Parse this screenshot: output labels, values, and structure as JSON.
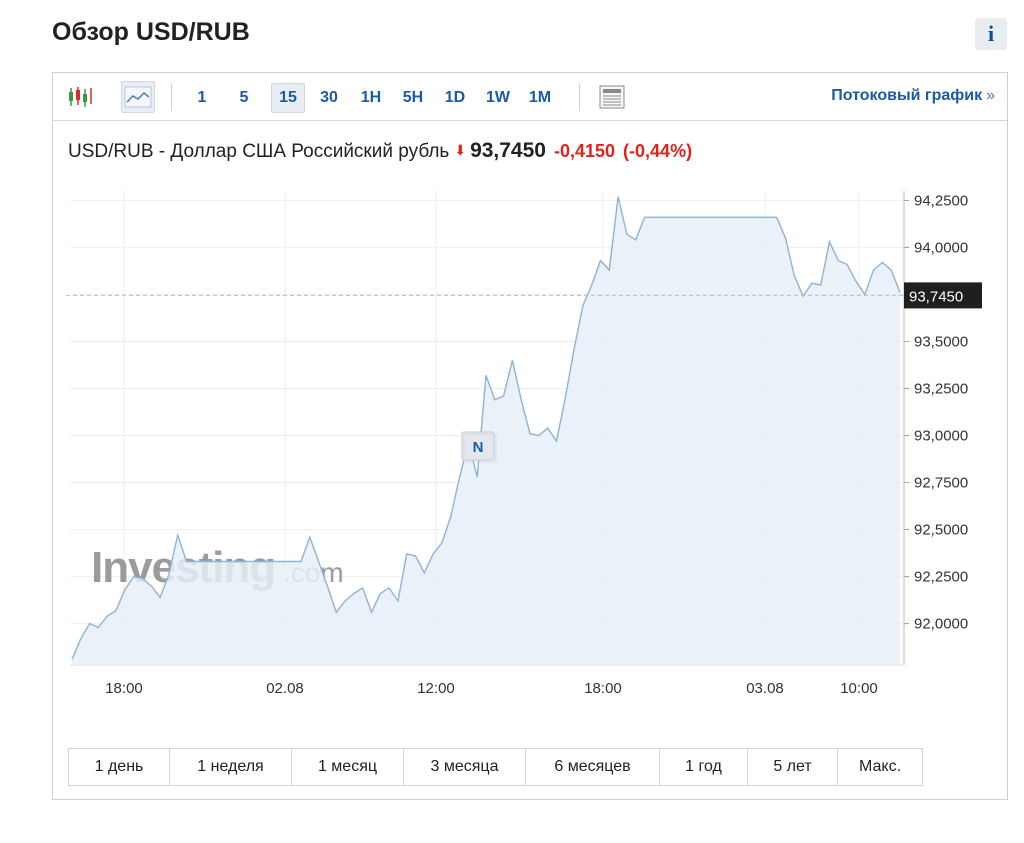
{
  "page": {
    "title": "Обзор USD/RUB",
    "info_label": "i"
  },
  "toolbar": {
    "timeframes": [
      "1",
      "5",
      "15",
      "30",
      "1H",
      "5H",
      "1D",
      "1W",
      "1M"
    ],
    "active_timeframe": "15",
    "stream_link": "Потоковый график",
    "stream_arrow": "»",
    "icons": [
      "candlestick-chart-icon",
      "area-chart-icon",
      "table-view-icon"
    ]
  },
  "quote": {
    "name": "USD/RUB - Доллар США Российский рубль",
    "price": "93,7450",
    "change": "-0,4150",
    "change_pct": "(-0,44%)",
    "direction_icon": "down-arrow-icon"
  },
  "watermark": {
    "brand": "Investing",
    "suffix": ".com"
  },
  "news_marker": "N",
  "ranges": [
    "1 день",
    "1 неделя",
    "1 месяц",
    "3 месяца",
    "6 месяцев",
    "1 год",
    "5 лет",
    "Макс."
  ],
  "colors": {
    "accent": "#1a5aa6",
    "down": "#e0231d",
    "line": "#8fb3d6",
    "fill": "#e8eef7",
    "price_tag_bg": "#1f1f1f"
  },
  "chart_data": {
    "type": "area",
    "x_ticks": [
      "18:00",
      "02.08",
      "12:00",
      "18:00",
      "03.08",
      "10:00"
    ],
    "y_ticks": [
      "92,0000",
      "92,2500",
      "92,5000",
      "92,7500",
      "93,0000",
      "93,2500",
      "93,5000",
      "93,7500",
      "94,0000",
      "94,2500"
    ],
    "ylim": [
      91.78,
      94.3
    ],
    "current_price_label": "93,7450",
    "current_price": 93.745,
    "grid": true,
    "series": [
      {
        "values": [
          91.81,
          91.92,
          92.0,
          91.98,
          92.04,
          92.07,
          92.18,
          92.25,
          92.24,
          92.2,
          92.14,
          92.26,
          92.47,
          92.33,
          92.33,
          92.33,
          92.33,
          92.33,
          92.33,
          92.33,
          92.33,
          92.33,
          92.33,
          92.33,
          92.33,
          92.33,
          92.33,
          92.46,
          92.33,
          92.2,
          92.06,
          92.12,
          92.16,
          92.19,
          92.06,
          92.16,
          92.19,
          92.12,
          92.37,
          92.36,
          92.27,
          92.37,
          92.43,
          92.57,
          92.78,
          92.96,
          92.78,
          93.32,
          93.19,
          93.21,
          93.4,
          93.19,
          93.01,
          93.0,
          93.04,
          92.97,
          93.2,
          93.46,
          93.69,
          93.8,
          93.93,
          93.88,
          94.27,
          94.07,
          94.04,
          94.16,
          94.16,
          94.16,
          94.16,
          94.16,
          94.16,
          94.16,
          94.16,
          94.16,
          94.16,
          94.16,
          94.16,
          94.16,
          94.16,
          94.16,
          94.16,
          94.05,
          93.85,
          93.74,
          93.81,
          93.8,
          94.03,
          93.93,
          93.91,
          93.82,
          93.75,
          93.88,
          93.92,
          93.88,
          93.76
        ]
      }
    ]
  }
}
